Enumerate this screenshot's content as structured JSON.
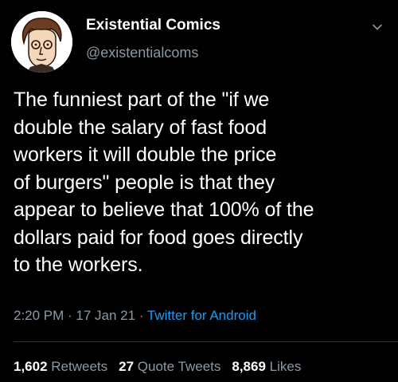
{
  "author": {
    "name": "Existential Comics",
    "handle": "@existentialcoms"
  },
  "tweet": {
    "text": "The funniest part of the \"if we\ndouble the salary of fast food\nworkers it will double the price\nof burgers\" people is that they\nappear to believe that 100% of the\ndollars paid for food goes directly\nto the workers.",
    "time": "2:20 PM",
    "separator_1": " · ",
    "date": "17 Jan 21",
    "separator_2": " · ",
    "source": "Twitter for Android"
  },
  "stats": {
    "retweets_count": "1,602",
    "retweets_label": " Retweets",
    "quotes_count": "27",
    "quotes_label": " Quote Tweets",
    "likes_count": "8,869",
    "likes_label": " Likes"
  },
  "icons": {
    "avatar": "avatar-cartoon-face",
    "menu": "chevron-down-icon"
  },
  "colors": {
    "background": "#000000",
    "primary_text": "#ffffff",
    "secondary_text": "#8b98a5",
    "link": "#1d9bf0",
    "divider": "#2f3336"
  }
}
